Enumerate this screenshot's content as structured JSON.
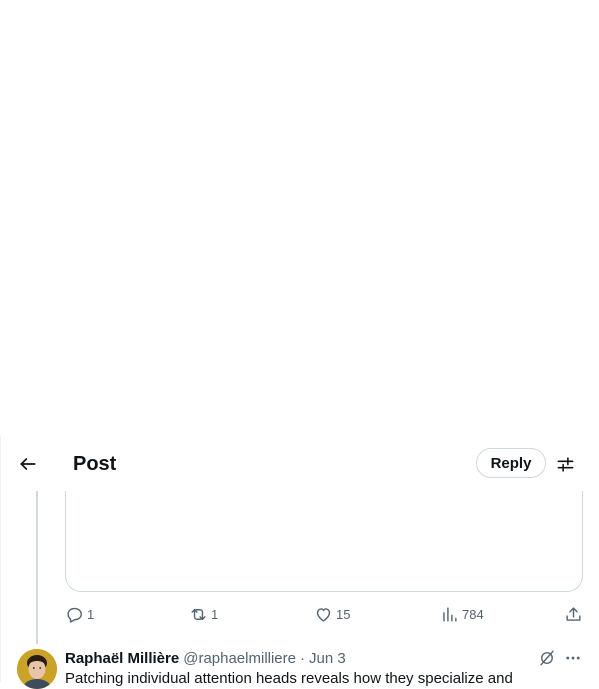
{
  "header": {
    "title": "Post",
    "reply_label": "Reply",
    "back_icon": "arrow-left-icon",
    "adjust_icon": "sliders-icon"
  },
  "actions": {
    "replies": "1",
    "reposts": "1",
    "likes": "15",
    "views": "784"
  },
  "next_tweet": {
    "author_name": "Raphaël Millière",
    "author_handle": "@raphaelmilliere",
    "separator": "·",
    "time": "Jun 3",
    "text": "Patching individual attention heads reveals how they specialize and"
  },
  "colors": {
    "text_primary": "#0f1419",
    "text_secondary": "#536471",
    "border": "#cfd9de",
    "avatar_bg": "#c9a227"
  }
}
